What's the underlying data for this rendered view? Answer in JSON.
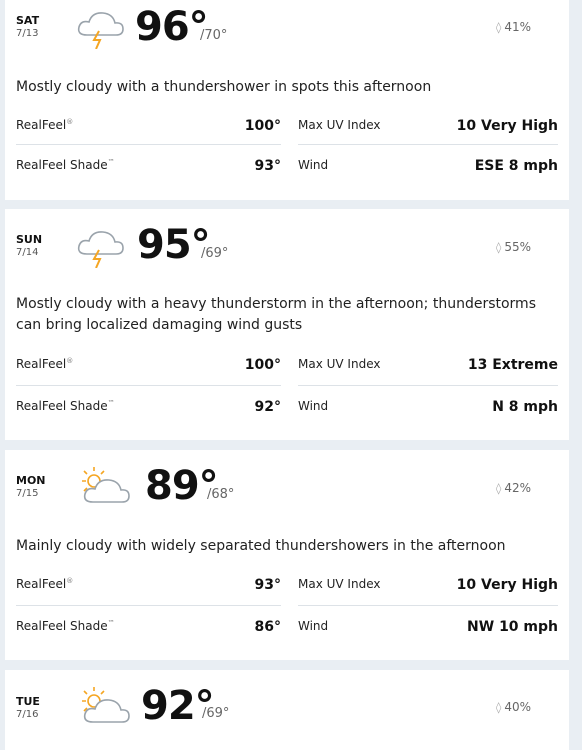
{
  "days": [
    {
      "dow": "SAT",
      "date": "7/13",
      "icon": "thunderstorm-icon",
      "hi": "96°",
      "lo": "/70°",
      "precip": "41%",
      "phrase": "Mostly cloudy with a thundershower in spots this afternoon",
      "realfeel_label": "RealFeel",
      "realfeel": "100°",
      "uv_label": "Max UV Index",
      "uv": "10 Very High",
      "shade_label": "RealFeel Shade",
      "shade": "93°",
      "wind_label": "Wind",
      "wind": "ESE 8 mph"
    },
    {
      "dow": "SUN",
      "date": "7/14",
      "icon": "thunderstorm-icon",
      "hi": "95°",
      "lo": "/69°",
      "precip": "55%",
      "phrase": "Mostly cloudy with a heavy thunderstorm in the afternoon; thunderstorms can bring localized damaging wind gusts",
      "realfeel_label": "RealFeel",
      "realfeel": "100°",
      "uv_label": "Max UV Index",
      "uv": "13 Extreme",
      "shade_label": "RealFeel Shade",
      "shade": "92°",
      "wind_label": "Wind",
      "wind": "N 8 mph"
    },
    {
      "dow": "MON",
      "date": "7/15",
      "icon": "partly-sunny-icon",
      "hi": "89°",
      "lo": "/68°",
      "precip": "42%",
      "phrase": "Mainly cloudy with widely separated thundershowers in the afternoon",
      "realfeel_label": "RealFeel",
      "realfeel": "93°",
      "uv_label": "Max UV Index",
      "uv": "10 Very High",
      "shade_label": "RealFeel Shade",
      "shade": "86°",
      "wind_label": "Wind",
      "wind": "NW 10 mph"
    },
    {
      "dow": "TUE",
      "date": "7/16",
      "icon": "partly-sunny-icon",
      "hi": "92°",
      "lo": "/69°",
      "precip": "40%"
    }
  ],
  "colors": {
    "bolt": "#f5a623",
    "sun": "#f5a623",
    "cloud": "#9aa3ab",
    "page_bg": "#e9eef3"
  }
}
